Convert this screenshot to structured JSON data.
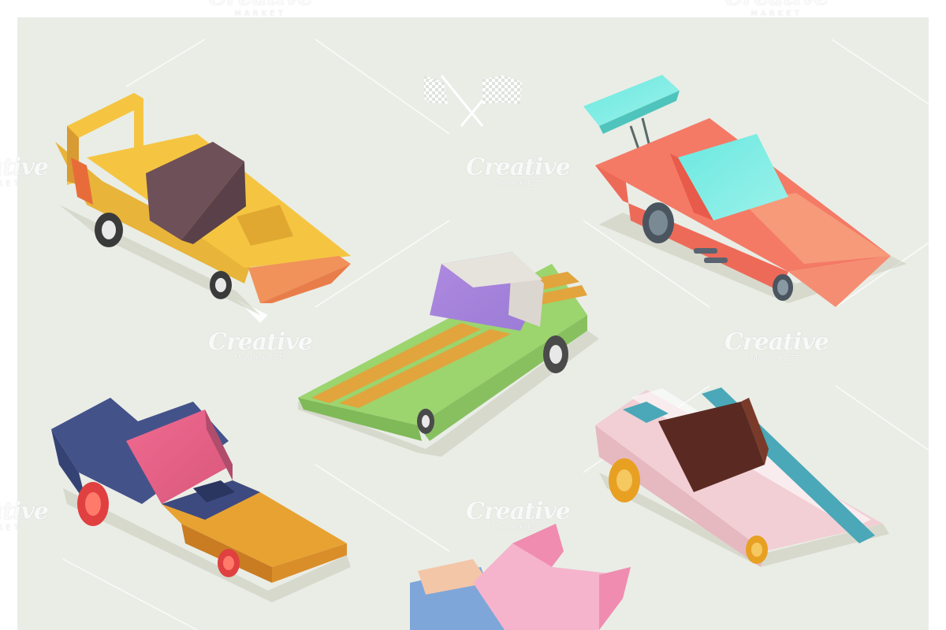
{
  "watermark": {
    "brand": "Creative",
    "sub": "MARKET"
  },
  "colors": {
    "background": "#e9ede6",
    "frame": "#ffffff",
    "yellow_car": "#f5c542",
    "coral_car": "#f47a66",
    "green_car": "#9cd46e",
    "navy_car": "#44528a",
    "pink_car": "#f1cfd4",
    "blue_car": "#7fa6d8"
  },
  "icons": {
    "flags": "crossed-checkered-flags-icon"
  }
}
